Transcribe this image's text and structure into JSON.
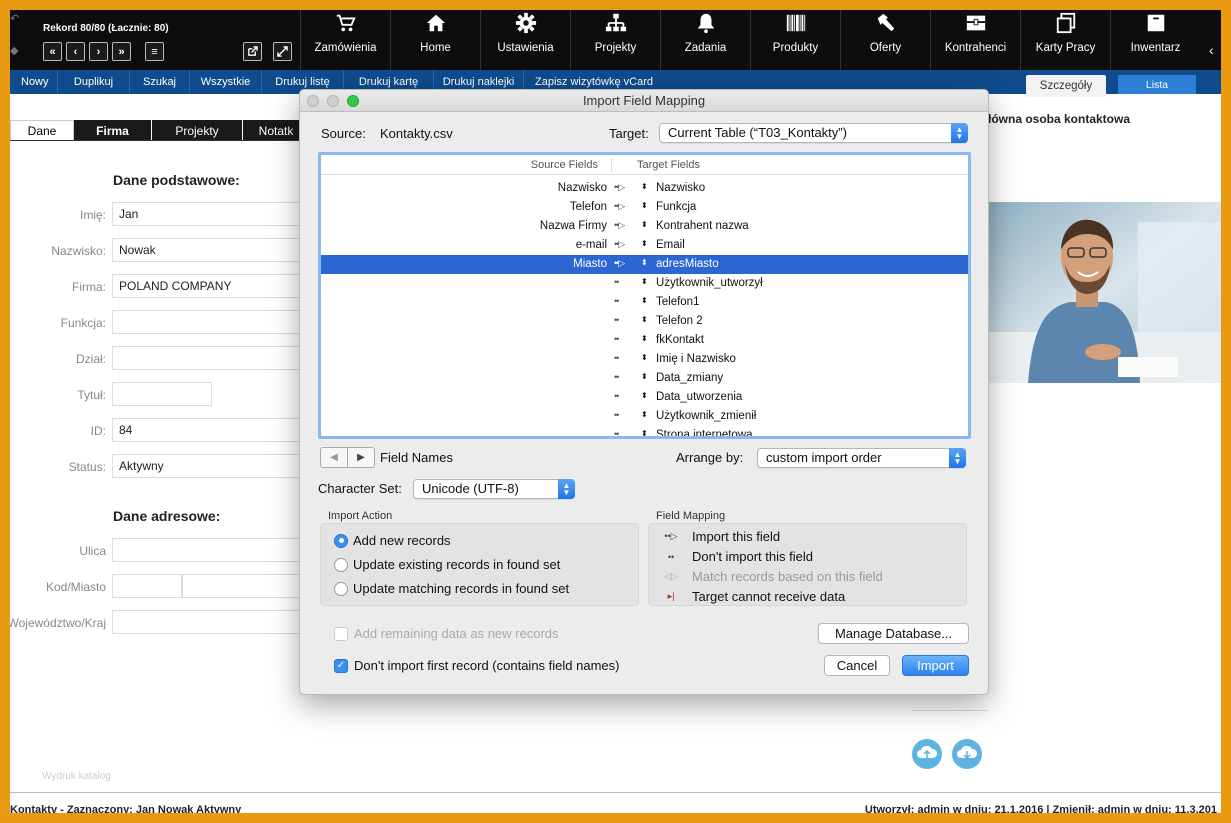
{
  "header": {
    "record_title": "Rekord 80/80 (Łacznie: 80)",
    "nav_buttons": [
      "«",
      "‹",
      "›",
      "»",
      "≡"
    ],
    "nav_items": [
      {
        "label": "Zamówienia",
        "icon": "cart-icon"
      },
      {
        "label": "Home",
        "icon": "home-icon"
      },
      {
        "label": "Ustawienia",
        "icon": "gear-icon"
      },
      {
        "label": "Projekty",
        "icon": "hierarchy-icon"
      },
      {
        "label": "Zadania",
        "icon": "bell-icon"
      },
      {
        "label": "Produkty",
        "icon": "barcode-icon"
      },
      {
        "label": "Oferty",
        "icon": "hammer-icon"
      },
      {
        "label": "Kontrahenci",
        "icon": "register-icon"
      },
      {
        "label": "Karty Pracy",
        "icon": "copy-icon"
      },
      {
        "label": "Inwentarz",
        "icon": "box-icon"
      }
    ]
  },
  "toolbar": {
    "items": [
      "Nowy",
      "Duplikuj",
      "Szukaj",
      "Wszystkie",
      "Drukuj listę",
      "Drukuj kartę",
      "Drukuj naklejki",
      "Zapisz wizytówkę vCard"
    ],
    "tab_details": "Szczegóły",
    "tab_list": "Lista"
  },
  "form": {
    "tabs": [
      "Dane",
      "Firma",
      "Projekty",
      "Notatk"
    ],
    "section_basic": "Dane podstawowe:",
    "section_address": "Dane adresowe:",
    "fields": [
      {
        "label": "Imię:",
        "value": "Jan"
      },
      {
        "label": "Nazwisko:",
        "value": "Nowak"
      },
      {
        "label": "Firma:",
        "value": "POLAND COMPANY"
      },
      {
        "label": "Funkcja:",
        "value": ""
      },
      {
        "label": "Dział:",
        "value": ""
      },
      {
        "label": "Tytuł:",
        "value": ""
      },
      {
        "label": "ID:",
        "value": "84"
      },
      {
        "label": "Status:",
        "value": "Aktywny"
      }
    ],
    "address_fields": [
      {
        "label": "Ulica",
        "value": ""
      },
      {
        "label": "Kod/Miasto",
        "value": ""
      },
      {
        "label": "Województwo/Kraj",
        "value": ""
      }
    ],
    "right_heading": "łówna osoba kontaktowa",
    "faint_text": "Wydruk katalog"
  },
  "status": {
    "left": "Kontakty - Zaznaczony: Jan Nowak Aktywny",
    "right": "Utworzył: admin w dniu: 21.1.2016 | Zmienił: admin w dniu: 11.3.201"
  },
  "dialog": {
    "title": "Import Field Mapping",
    "source_label": "Source:",
    "source_value": "Kontakty.csv",
    "target_label": "Target:",
    "target_value": "Current Table (“T03_Kontakty”)",
    "col_source": "Source Fields",
    "col_target": "Target Fields",
    "rows": [
      {
        "source": "Nazwisko",
        "arrow": "••▷",
        "target": "Nazwisko"
      },
      {
        "source": "Telefon",
        "arrow": "••▷",
        "target": "Funkcja"
      },
      {
        "source": "Nazwa Firmy",
        "arrow": "••▷",
        "target": "Kontrahent nazwa"
      },
      {
        "source": "e-mail",
        "arrow": "••▷",
        "target": "Email"
      },
      {
        "source": "Miasto",
        "arrow": "••▷",
        "target": "adresMiasto"
      },
      {
        "source": "",
        "arrow": "••",
        "target": "Użytkownik_utworzył"
      },
      {
        "source": "",
        "arrow": "••",
        "target": "Telefon1"
      },
      {
        "source": "",
        "arrow": "••",
        "target": "Telefon 2"
      },
      {
        "source": "",
        "arrow": "••",
        "target": "fkKontakt"
      },
      {
        "source": "",
        "arrow": "••",
        "target": "Imię i Nazwisko"
      },
      {
        "source": "",
        "arrow": "••",
        "target": "Data_zmiany"
      },
      {
        "source": "",
        "arrow": "••",
        "target": "Data_utworzenia"
      },
      {
        "source": "",
        "arrow": "••",
        "target": "Użytkownik_zmienił"
      },
      {
        "source": "",
        "arrow": "••",
        "target": "Strona internetowa"
      }
    ],
    "selected_row": 4,
    "field_names_label": "Field Names",
    "arrange_label": "Arrange by:",
    "arrange_value": "custom import order",
    "charset_label": "Character Set:",
    "charset_value": "Unicode (UTF-8)",
    "import_action_title": "Import Action",
    "import_actions": [
      "Add new records",
      "Update existing records in found set",
      "Update matching records in found set"
    ],
    "selected_action": 0,
    "field_mapping_title": "Field Mapping",
    "mapping_legend": [
      {
        "symbol": "••▷",
        "label": "Import this field"
      },
      {
        "symbol": "••",
        "label": "Don't import this field"
      },
      {
        "symbol": "◁▷",
        "label": "Match records based on this field"
      },
      {
        "symbol": "▸|",
        "label": "Target cannot receive data"
      }
    ],
    "add_remaining": "Add remaining data as new records",
    "dont_import_first": "Don't import first record (contains field names)",
    "manage_db": "Manage Database...",
    "cancel": "Cancel",
    "import": "Import",
    "colors": {
      "accent": "#2c66d2",
      "button": "#2a82ec"
    }
  }
}
